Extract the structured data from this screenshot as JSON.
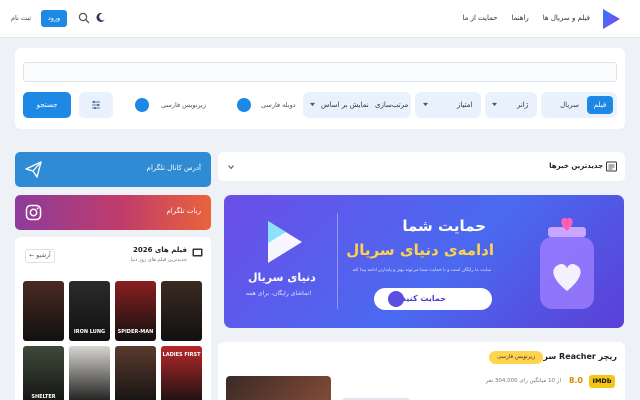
{
  "header": {
    "nav": [
      "فیلم و سریال ها",
      "راهنما",
      "حمایت از ما"
    ],
    "login": "ورود",
    "register": "ثبت نام"
  },
  "search": {
    "placeholder": "",
    "type_active": "فیلم",
    "type_other": "سریال",
    "genre": "ژانر",
    "rating": "امتیاز",
    "sort_label": "مرتب‌سازی",
    "sort_value": "نمایش بر اساس",
    "dubbed": "دوبله فارسی",
    "subtitle": "زیرنویس فارسی",
    "submit": "جستجو"
  },
  "sidebar": {
    "telegram_channel": "آدرس کانال تلگرام",
    "telegram_bot": "ربات تلگرام",
    "films_title": "فیلم های 2026",
    "films_subtitle": "جدیدترین فیلم های روز دنیا",
    "archive": "آرشیو",
    "posters": [
      {
        "label": "",
        "color": "#3b2a22"
      },
      {
        "label": "IRON LUNG",
        "color": "#2b2b2b"
      },
      {
        "label": "SPIDER-MAN",
        "color": "#8a1f1f"
      },
      {
        "label": "",
        "color": "#4a2a22"
      },
      {
        "label": "SHELTER",
        "color": "#3f4a3a"
      },
      {
        "label": "",
        "color": "#d8d6d0"
      },
      {
        "label": "",
        "color": "#5a3a2e"
      },
      {
        "label": "LADIES FIRST",
        "color": "#b8282a"
      }
    ]
  },
  "news": {
    "title": "جدیدترین خبرها"
  },
  "banner": {
    "title1": "حمایت شما",
    "title2": "ادامه‌ی دنیای سریال",
    "description": "سایت ما رایگان است و با حمایت شما می‌تونه بهتر و پایدارتر ادامه پیدا کنه",
    "button": "حمایت کنید",
    "brand": "دنیای سریال",
    "brand_sub": "تماشای رایگان، برای همه!"
  },
  "series": {
    "title": "سریال Reacher ریچر",
    "badge": "زیرنویس فارسی",
    "imdb": "IMDb",
    "score": "8.0",
    "votes": "از 10 میانگین رای 304,000 نفر"
  },
  "colors": {
    "accent": "#1e88e5",
    "badge": "#ffd34d",
    "imdb": "#f5c518"
  }
}
